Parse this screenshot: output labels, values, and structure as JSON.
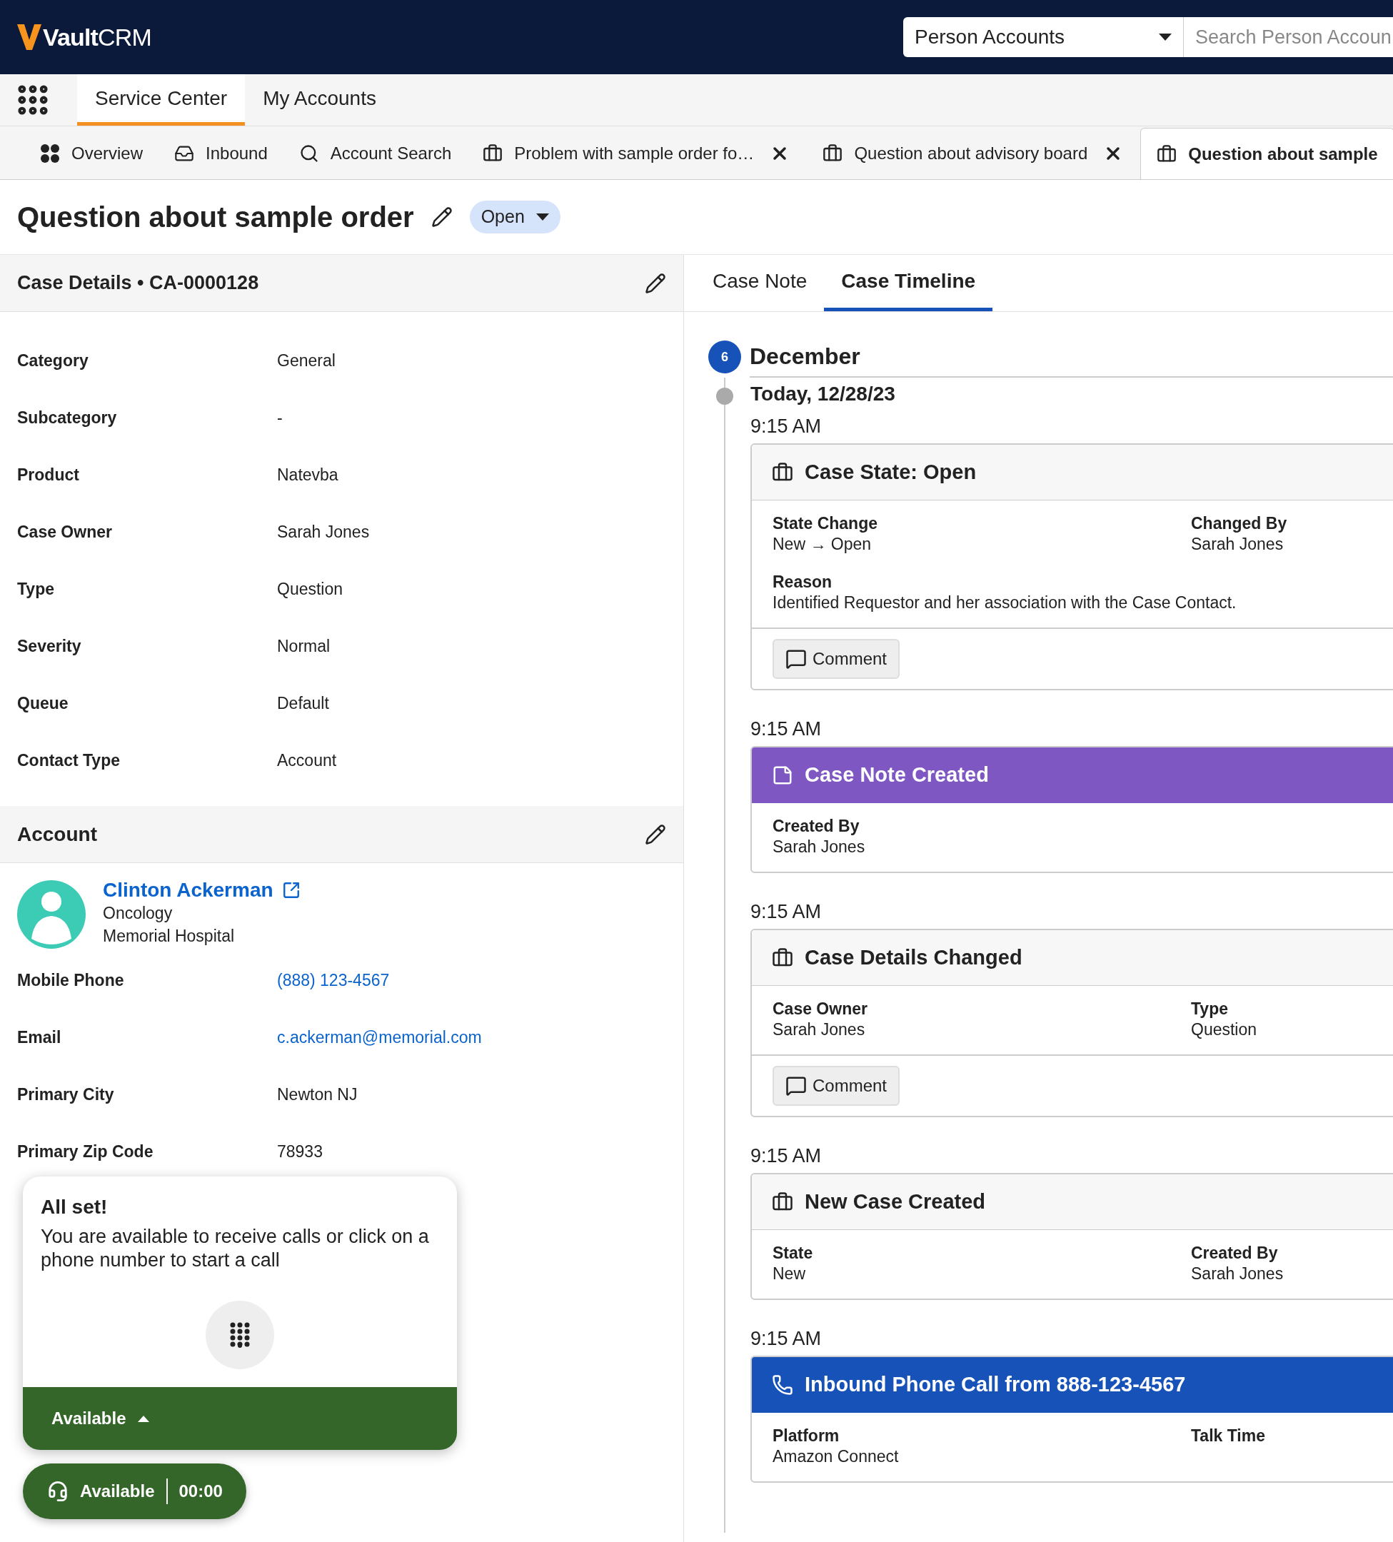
{
  "header": {
    "logo": "**Vault**CRM",
    "object_select": {
      "value": "Person Accounts"
    },
    "search": {
      "placeholder": "Search Person Accoun"
    }
  },
  "nav_tabs": [
    {
      "label": "Service Center",
      "selected": true
    },
    {
      "label": "My Accounts",
      "selected": false
    }
  ],
  "workspace_tabs": [
    {
      "kind": "overview",
      "label": "Overview",
      "closable": false,
      "selected": false
    },
    {
      "kind": "inbox",
      "label": "Inbound",
      "closable": false,
      "selected": false
    },
    {
      "kind": "search",
      "label": "Account Search",
      "closable": false,
      "selected": false
    },
    {
      "kind": "case",
      "label": "Problem with sample order fo…",
      "closable": true,
      "selected": false
    },
    {
      "kind": "case",
      "label": "Question about advisory board",
      "closable": true,
      "selected": false
    },
    {
      "kind": "case",
      "label": "Question about sample",
      "closable": false,
      "selected": true
    }
  ],
  "page": {
    "title": "Question about sample order",
    "status": "Open"
  },
  "case_details": {
    "title": "Case Details • CA-0000128",
    "fields": [
      {
        "label": "Category",
        "value": "General"
      },
      {
        "label": "Subcategory",
        "value": "-"
      },
      {
        "label": "Product",
        "value": "Natevba"
      },
      {
        "label": "Case Owner",
        "value": "Sarah Jones"
      },
      {
        "label": "Type",
        "value": "Question"
      },
      {
        "label": "Severity",
        "value": "Normal"
      },
      {
        "label": "Queue",
        "value": "Default"
      },
      {
        "label": "Contact Type",
        "value": "Account"
      }
    ]
  },
  "account": {
    "title": "Account",
    "name": "Clinton Ackerman",
    "specialty": "Oncology",
    "organization": "Memorial Hospital",
    "fields": [
      {
        "label": "Mobile Phone",
        "value": "(888) 123-4567",
        "kind": "link"
      },
      {
        "label": "Email",
        "value": "c.ackerman@memorial.com",
        "kind": "link"
      },
      {
        "label": "Primary City",
        "value": "Newton NJ",
        "kind": "text"
      },
      {
        "label": "Primary Zip Code",
        "value": "78933",
        "kind": "text"
      }
    ]
  },
  "detail_tabs": [
    {
      "label": "Case Note",
      "selected": false
    },
    {
      "label": "Case Timeline",
      "selected": true
    }
  ],
  "timeline": {
    "count": "6",
    "month": "December",
    "day": "Today, 12/28/23",
    "events": [
      {
        "time": "9:15 AM",
        "kind": "case",
        "title": "Case State: Open",
        "fields": [
          {
            "label": "State Change",
            "value": "New → Open"
          },
          {
            "label": "Changed By",
            "value": "Sarah Jones"
          }
        ],
        "reason": {
          "label": "Reason",
          "value": "Identified Requestor and her association with the Case Contact."
        },
        "comment": "Comment"
      },
      {
        "time": "9:15 AM",
        "kind": "note",
        "title": "Case Note Created",
        "fields": [
          {
            "label": "Created By",
            "value": "Sarah Jones"
          }
        ]
      },
      {
        "time": "9:15 AM",
        "kind": "case",
        "title": "Case Details Changed",
        "fields": [
          {
            "label": "Case Owner",
            "value": "Sarah Jones"
          },
          {
            "label": "Type",
            "value": "Question"
          }
        ],
        "comment": "Comment"
      },
      {
        "time": "9:15 AM",
        "kind": "case",
        "title": "New Case Created",
        "fields": [
          {
            "label": "State",
            "value": "New"
          },
          {
            "label": "Created By",
            "value": "Sarah Jones"
          }
        ]
      },
      {
        "time": "9:15 AM",
        "kind": "call",
        "title": "Inbound Phone Call from 888-123-4567",
        "fields": [
          {
            "label": "Platform",
            "value": "Amazon Connect"
          },
          {
            "label": "Talk Time"
          }
        ]
      }
    ]
  },
  "softphone": {
    "title": "All set!",
    "message": "You are available to receive calls or click on a phone number to start a call",
    "status": "Available",
    "pill_status": "Available",
    "timer": "00:00"
  }
}
